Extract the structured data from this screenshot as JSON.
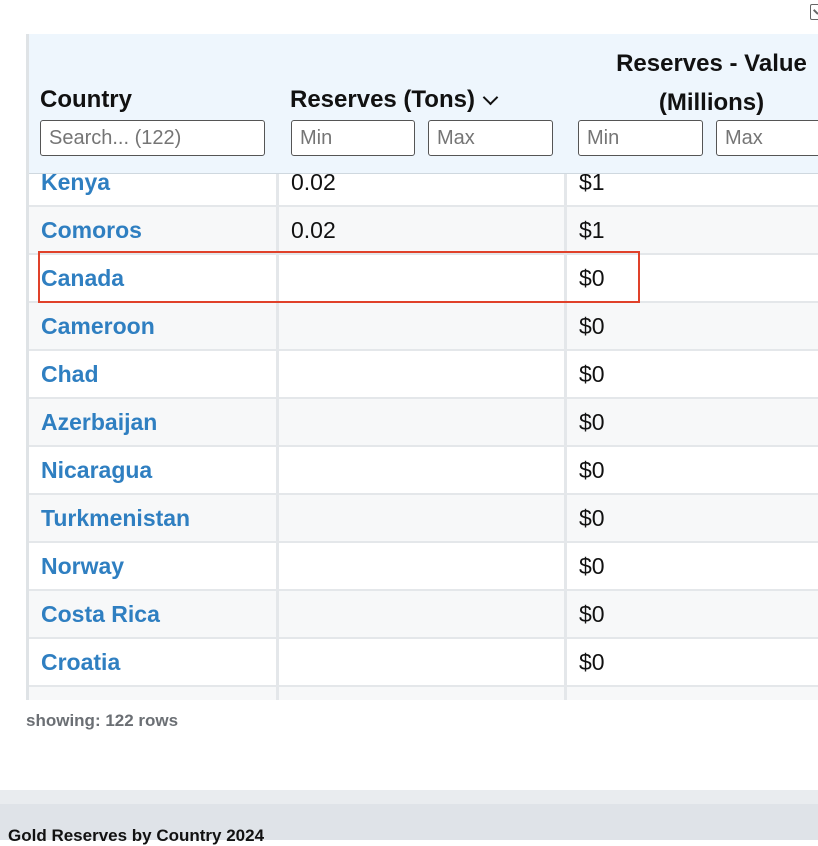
{
  "header": {
    "country_label": "Country",
    "tons_label": "Reserves (Tons)",
    "value_label_line1": "Reserves - Value",
    "value_label_line2": "(Millions)",
    "search_placeholder": "Search... (122)",
    "tons_min_placeholder": "Min",
    "tons_max_placeholder": "Max",
    "value_min_placeholder": "Min",
    "value_max_placeholder": "Max"
  },
  "rows": [
    {
      "country": "Kenya",
      "tons": "0.02",
      "value": "$1"
    },
    {
      "country": "Comoros",
      "tons": "0.02",
      "value": "$1"
    },
    {
      "country": "Canada",
      "tons": "",
      "value": "$0"
    },
    {
      "country": "Cameroon",
      "tons": "",
      "value": "$0"
    },
    {
      "country": "Chad",
      "tons": "",
      "value": "$0"
    },
    {
      "country": "Azerbaijan",
      "tons": "",
      "value": "$0"
    },
    {
      "country": "Nicaragua",
      "tons": "",
      "value": "$0"
    },
    {
      "country": "Turkmenistan",
      "tons": "",
      "value": "$0"
    },
    {
      "country": "Norway",
      "tons": "",
      "value": "$0"
    },
    {
      "country": "Costa Rica",
      "tons": "",
      "value": "$0"
    },
    {
      "country": "Croatia",
      "tons": "",
      "value": "$0"
    }
  ],
  "status": {
    "showing": "showing: 122 rows"
  },
  "footer": {
    "title": "Gold Reserves by Country 2024"
  },
  "colors": {
    "link": "#2f7fc1",
    "header_bg": "#eef6fd",
    "highlight": "#e0412a"
  },
  "icons": {
    "sort": "chevron-down-icon",
    "export": "export-icon"
  }
}
